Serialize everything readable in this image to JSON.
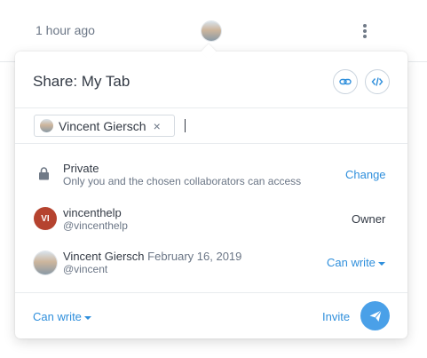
{
  "topbar": {
    "time_label": "1 hour ago"
  },
  "share": {
    "title": "Share: My Tab",
    "chip_label": "Vincent Giersch",
    "chip_remove": "×"
  },
  "privacy": {
    "title": "Private",
    "description": "Only you and the chosen collaborators can access",
    "change_label": "Change"
  },
  "collaborators": [
    {
      "initials": "VI",
      "name": "vincenthelp",
      "handle": "@vincenthelp",
      "role": "Owner"
    },
    {
      "name": "Vincent Giersch",
      "date": "February 16, 2019",
      "handle": "@vincent",
      "role": "Can write"
    }
  ],
  "footer": {
    "permission_label": "Can write",
    "invite_label": "Invite"
  },
  "colors": {
    "accent": "#2f8fdc",
    "send": "#4aa0e8",
    "avatar_vi": "#b5432f"
  }
}
